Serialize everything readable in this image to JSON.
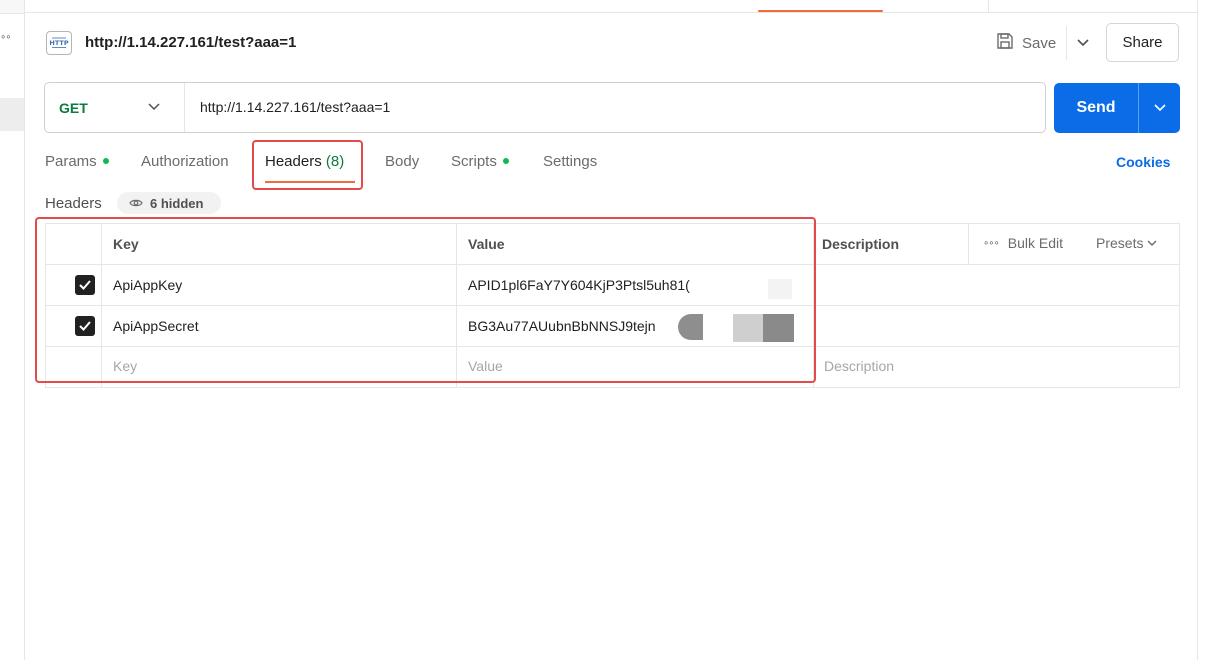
{
  "request": {
    "icon": "http-icon",
    "title": "http://1.14.227.161/test?aaa=1",
    "save_label": "Save",
    "share_label": "Share"
  },
  "url_bar": {
    "method": "GET",
    "url": "http://1.14.227.161/test?aaa=1",
    "send_label": "Send"
  },
  "tabs": [
    {
      "label": "Params",
      "dot": true
    },
    {
      "label": "Authorization",
      "dot": false
    },
    {
      "label": "Headers",
      "count": "(8)",
      "active": true
    },
    {
      "label": "Body",
      "dot": false
    },
    {
      "label": "Scripts",
      "dot": true
    },
    {
      "label": "Settings",
      "dot": false
    }
  ],
  "cookies_label": "Cookies",
  "headers_section": {
    "label": "Headers",
    "hidden_label": "6 hidden"
  },
  "table": {
    "columns": {
      "key": "Key",
      "value": "Value",
      "description": "Description"
    },
    "bulk_edit_label": "Bulk Edit",
    "presets_label": "Presets",
    "rows": [
      {
        "checked": true,
        "key": "ApiAppKey",
        "value": "APID1pl6FaY7Y604KjP3Ptsl5uh81("
      },
      {
        "checked": true,
        "key": "ApiAppSecret",
        "value": "BG3Au77AUubnBbNNSJ9tejn"
      }
    ],
    "placeholder": {
      "key": "Key",
      "value": "Value",
      "description": "Description"
    }
  },
  "colors": {
    "accent": "#0a6ce6",
    "method_green": "#0b7a3e",
    "tab_active": "#f26b3a",
    "annotation_red": "#e24b4b"
  }
}
